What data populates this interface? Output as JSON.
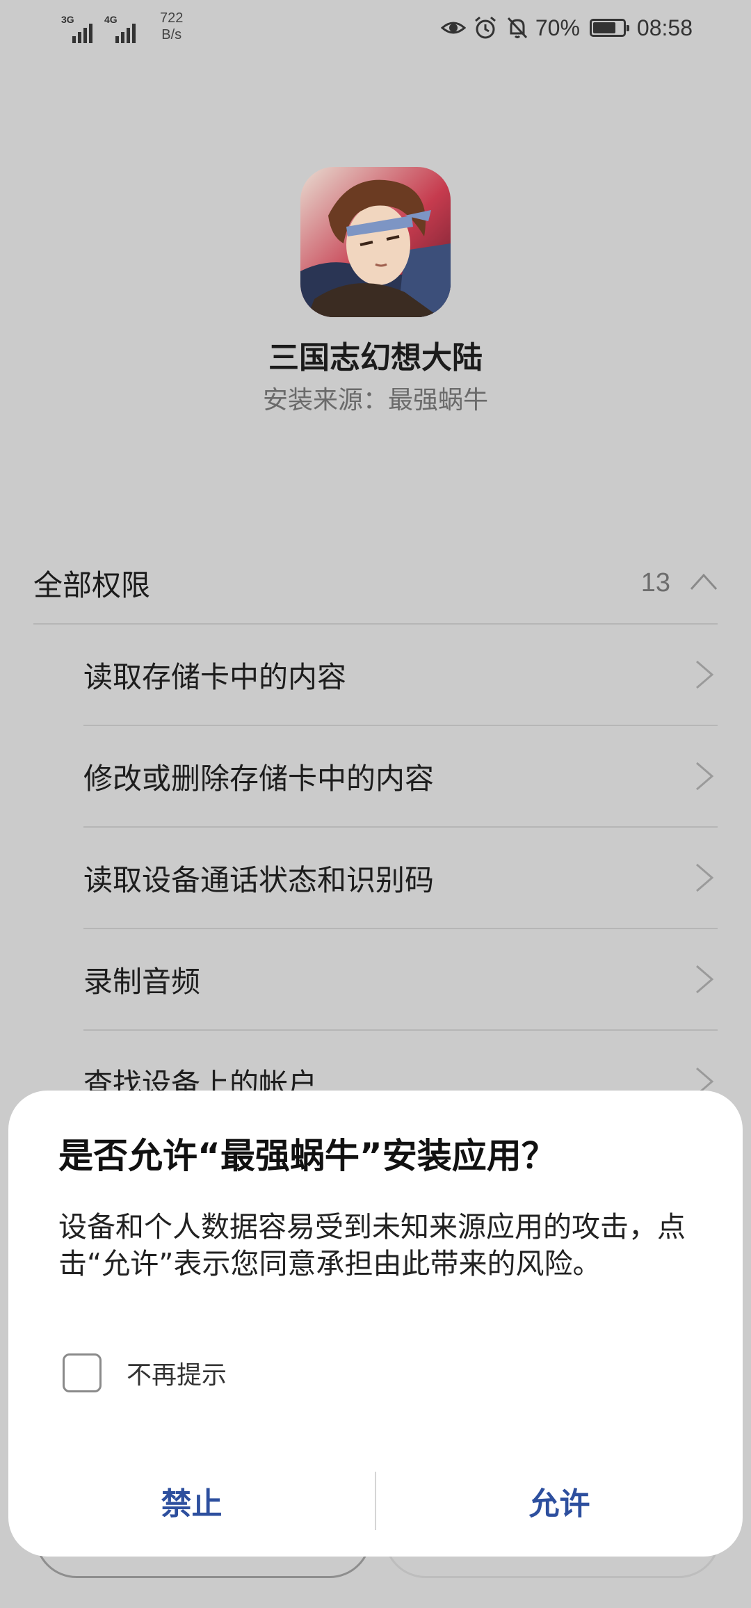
{
  "status_bar": {
    "sim1_network": "3G",
    "sim2_network": "4G",
    "speed_value": "722",
    "speed_unit": "B/s",
    "icons": [
      "eye-icon",
      "alarm-icon",
      "bell-off-icon",
      "battery-icon"
    ],
    "battery_percent": "70%",
    "battery_level": 0.7,
    "time": "08:58"
  },
  "app": {
    "name": "三国志幻想大陆",
    "source": "安装来源：最强蜗牛",
    "icon": "game-character-avatar"
  },
  "permissions": {
    "header_label": "全部权限",
    "count": "13",
    "items": [
      {
        "label": "读取存储卡中的内容"
      },
      {
        "label": "修改或删除存储卡中的内容"
      },
      {
        "label": "读取设备通话状态和识别码"
      },
      {
        "label": "录制音频"
      },
      {
        "label": "查找设备上的帐户"
      }
    ]
  },
  "dialog": {
    "title": "是否允许“最强蜗牛”安装应用？",
    "message": "设备和个人数据容易受到未知来源应用的攻击，点击“允许”表示您同意承担由此带来的风险。",
    "checkbox_label": "不再提示",
    "checkbox_checked": false,
    "deny_label": "禁止",
    "allow_label": "允许",
    "accent_color": "#2d4f9e"
  },
  "colors": {
    "scrim_background": "#cbcbcb",
    "dialog_background": "#ffffff"
  }
}
